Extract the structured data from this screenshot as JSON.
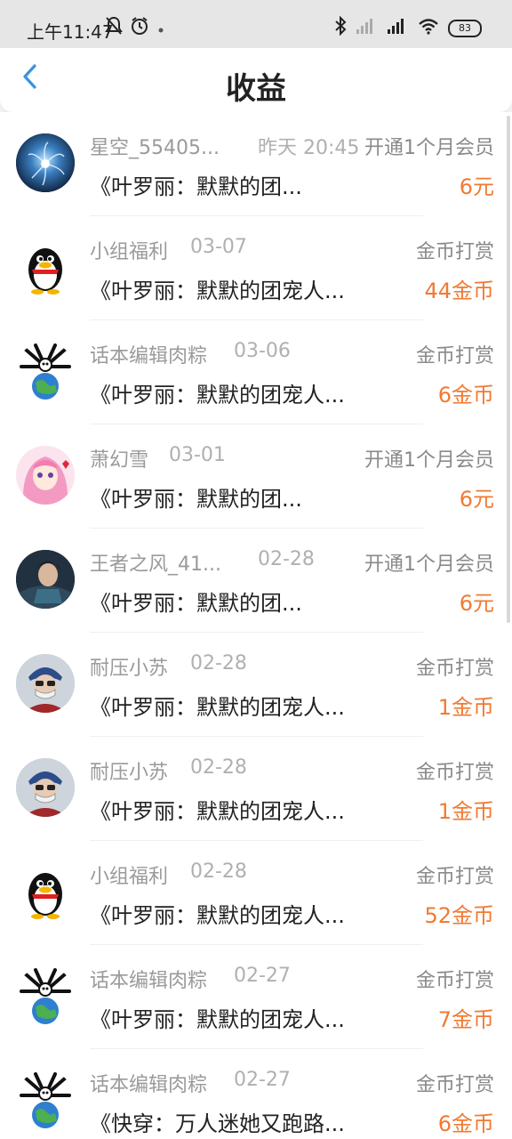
{
  "status_bar": {
    "time": "上午11:47",
    "battery": "83"
  },
  "header": {
    "title": "收益"
  },
  "colors": {
    "accent": "#f07a32",
    "back_icon": "#3a92e0"
  },
  "rows": [
    {
      "avatar": "nebula-flower-avatar",
      "name": "星空_55405...",
      "date": "昨天 20:45",
      "type": "开通1个月会员",
      "book": "《叶罗丽：默默的团...",
      "amount": "6元"
    },
    {
      "avatar": "qq-penguin-avatar",
      "name": "小组福利",
      "date": "03-07",
      "type": "金币打赏",
      "book": "《叶罗丽：默默的团宠人...",
      "amount": "44金币"
    },
    {
      "avatar": "earth-cartoon-avatar",
      "name": "话本编辑肉粽",
      "date": "03-06",
      "type": "金币打赏",
      "book": "《叶罗丽：默默的团宠人...",
      "amount": "6金币"
    },
    {
      "avatar": "anime-girl-avatar",
      "name": "萧幻雪",
      "date": "03-01",
      "type": "开通1个月会员",
      "book": "《叶罗丽：默默的团...",
      "amount": "6元"
    },
    {
      "avatar": "anime-man-avatar",
      "name": "王者之风_41...",
      "date": "02-28",
      "type": "开通1个月会员",
      "book": "《叶罗丽：默默的团...",
      "amount": "6元"
    },
    {
      "avatar": "masked-person-avatar",
      "name": "耐压小苏",
      "date": "02-28",
      "type": "金币打赏",
      "book": "《叶罗丽：默默的团宠人...",
      "amount": "1金币"
    },
    {
      "avatar": "masked-person-avatar",
      "name": "耐压小苏",
      "date": "02-28",
      "type": "金币打赏",
      "book": "《叶罗丽：默默的团宠人...",
      "amount": "1金币"
    },
    {
      "avatar": "qq-penguin-avatar",
      "name": "小组福利",
      "date": "02-28",
      "type": "金币打赏",
      "book": "《叶罗丽：默默的团宠人...",
      "amount": "52金币"
    },
    {
      "avatar": "earth-cartoon-avatar",
      "name": "话本编辑肉粽",
      "date": "02-27",
      "type": "金币打赏",
      "book": "《叶罗丽：默默的团宠人...",
      "amount": "7金币"
    },
    {
      "avatar": "earth-cartoon-avatar",
      "name": "话本编辑肉粽",
      "date": "02-27",
      "type": "金币打赏",
      "book": "《快穿：万人迷她又跑路...",
      "amount": "6金币"
    }
  ]
}
